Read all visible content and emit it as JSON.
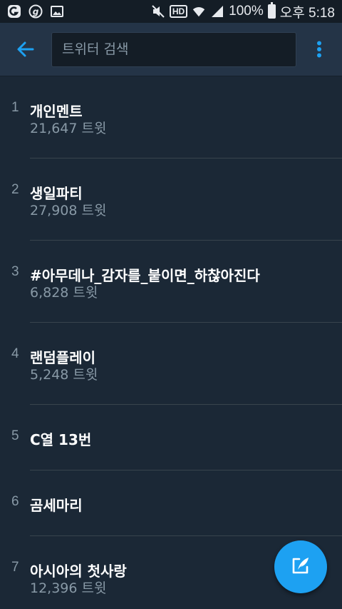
{
  "status_bar": {
    "battery_percent": "100%",
    "time": "오후 5:18",
    "hd_label": "HD",
    "battery_level": 1.0,
    "icons": [
      "app-icon",
      "g-icon",
      "gallery-icon",
      "mute-icon",
      "hd-icon",
      "wifi-icon",
      "signal-icon",
      "battery-icon"
    ]
  },
  "app_bar": {
    "back_icon": "back-arrow-icon",
    "search_placeholder": "트위터 검색",
    "menu_icon": "more-vert-icon"
  },
  "trends": [
    {
      "rank": "1",
      "name": "개인멘트",
      "count": "21,647 트윗"
    },
    {
      "rank": "2",
      "name": "생일파티",
      "count": "27,908 트윗"
    },
    {
      "rank": "3",
      "name": "#아무데나_감자를_붙이면_하찮아진다",
      "count": "6,828 트윗"
    },
    {
      "rank": "4",
      "name": "랜덤플레이",
      "count": "5,248 트윗"
    },
    {
      "rank": "5",
      "name": "C열 13번"
    },
    {
      "rank": "6",
      "name": "곰세마리"
    },
    {
      "rank": "7",
      "name": "아시아의 첫사랑",
      "count": "12,396 트윗"
    }
  ],
  "fab": {
    "icon": "compose-tweet-icon"
  },
  "colors": {
    "background": "#1b2836",
    "app_bar": "#243447",
    "accent": "#1da1f2",
    "secondary_text": "#8899a6"
  }
}
